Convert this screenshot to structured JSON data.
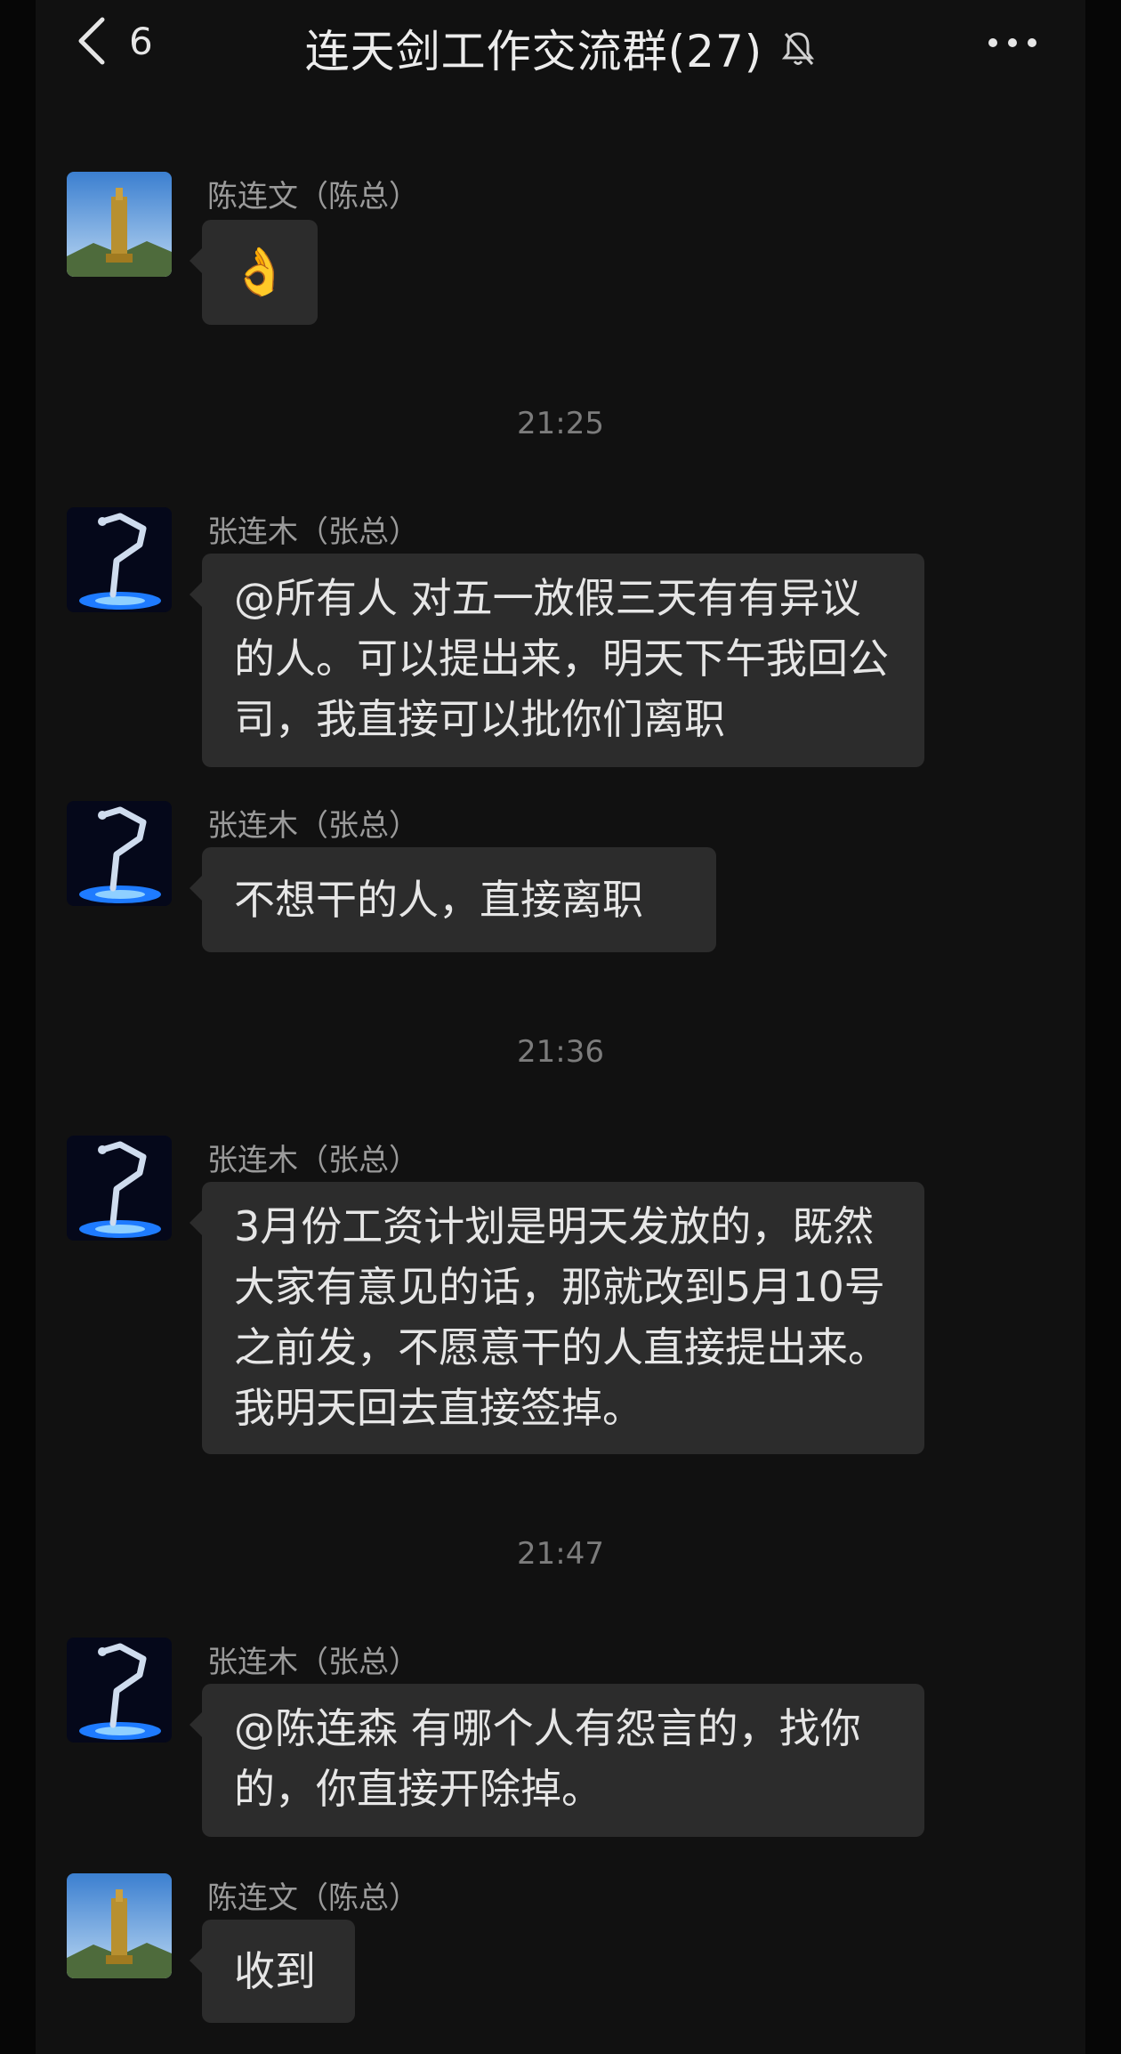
{
  "header": {
    "back_count": "6",
    "title": "连天剑工作交流群(27)"
  },
  "messages": [
    {
      "sender": "陈连文（陈总）",
      "text": "👌",
      "avatar": "tower-avatar"
    },
    {
      "timestamp": "21:25"
    },
    {
      "sender": "张连木（张总）",
      "text": "@所有人  对五一放假三天有有异议的人。可以提出来，明天下午我回公司，我直接可以批你们离职",
      "avatar": "robot-arm-avatar"
    },
    {
      "sender": "张连木（张总）",
      "text": "不想干的人，直接离职",
      "avatar": "robot-arm-avatar"
    },
    {
      "timestamp": "21:36"
    },
    {
      "sender": "张连木（张总）",
      "text": "3月份工资计划是明天发放的，既然大家有意见的话，那就改到5月10号之前发，不愿意干的人直接提出来。我明天回去直接签掉。",
      "avatar": "robot-arm-avatar"
    },
    {
      "timestamp": "21:47"
    },
    {
      "sender": "张连木（张总）",
      "text": "@陈连森  有哪个人有怨言的，找你的，你直接开除掉。",
      "avatar": "robot-arm-avatar"
    },
    {
      "sender": "陈连文（陈总）",
      "text": "收到",
      "avatar": "tower-avatar"
    }
  ],
  "colors": {
    "background": "#111111",
    "bubble": "#2c2c2c",
    "text": "#e6e6e6",
    "meta": "#9a9a9a"
  }
}
